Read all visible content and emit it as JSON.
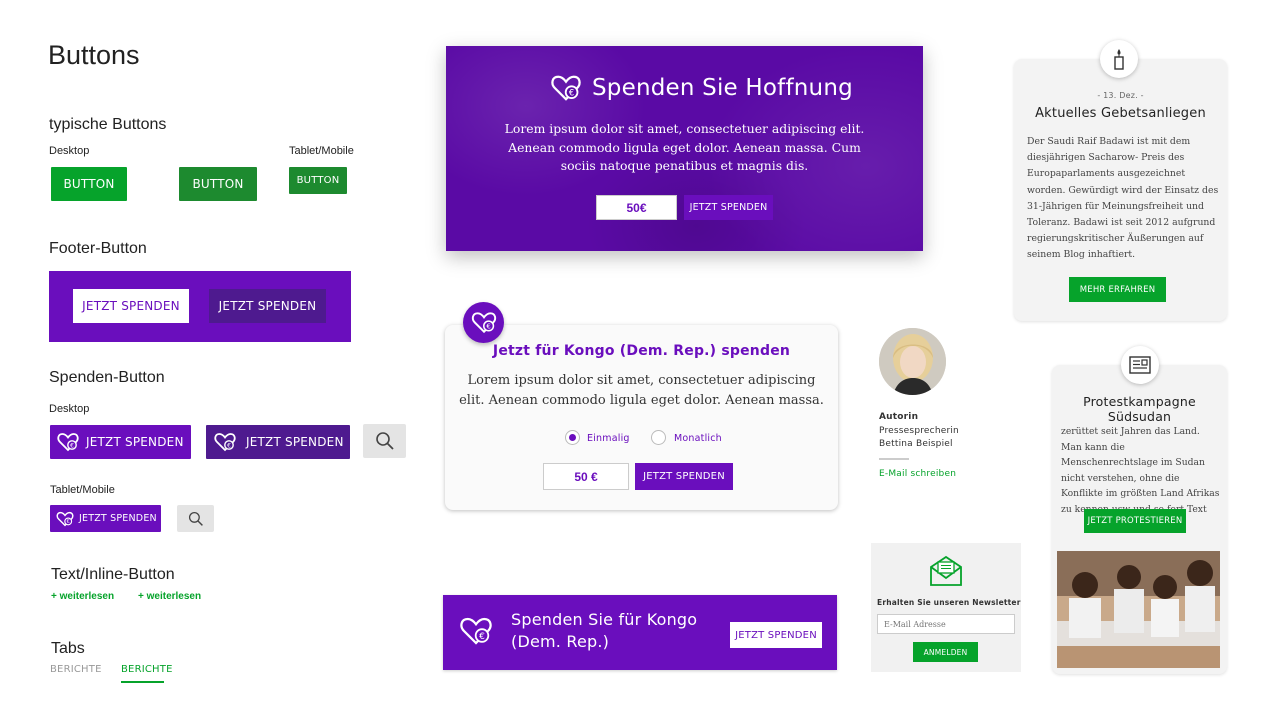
{
  "page": {
    "title": "Buttons"
  },
  "typical": {
    "heading": "typische Buttons",
    "desktop_label": "Desktop",
    "tablet_label": "Tablet/Mobile",
    "button_label": "BUTTON"
  },
  "footer_section": {
    "heading": "Footer-Button",
    "btn_primary": "JETZT SPENDEN",
    "btn_secondary": "JETZT SPENDEN"
  },
  "spenden_section": {
    "heading": "Spenden-Button",
    "desktop_label": "Desktop",
    "tablet_label": "Tablet/Mobile",
    "btn_label": "JETZT SPENDEN"
  },
  "inline_section": {
    "heading": "Text/Inline-Button",
    "link1": "+ weiterlesen",
    "link2": "+ weiterlesen"
  },
  "tabs_section": {
    "heading": "Tabs",
    "tab_inactive": "BERICHTE",
    "tab_active": "BERICHTE"
  },
  "hero": {
    "title": "Spenden Sie Hoffnung",
    "body": "Lorem ipsum dolor sit amet, consectetuer adipiscing elit. Aenean commodo ligula eget dolor. Aenean massa. Cum sociis natoque penatibus et magnis dis.",
    "amount": "50€",
    "button": "JETZT SPENDEN"
  },
  "donation_card": {
    "title": "Jetzt für Kongo (Dem. Rep.) spenden",
    "body": "Lorem ipsum dolor sit amet, consectetuer adipiscing elit. Aenean commodo ligula eget dolor. Aenean massa.",
    "option_once": "Einmalig",
    "option_monthly": "Monatlich",
    "amount": "50 €",
    "button": "JETZT SPENDEN"
  },
  "bottom_banner": {
    "title_line1": "Spenden Sie für Kongo",
    "title_line2": "(Dem. Rep.)",
    "button": "JETZT SPENDEN"
  },
  "author": {
    "label": "Autorin",
    "role": "Pressesprecherin",
    "name": "Bettina Beispiel",
    "email_link": "E-Mail schreiben"
  },
  "newsletter": {
    "label": "Erhalten Sie unseren Newsletter",
    "placeholder": "E-Mail Adresse",
    "button": "ANMELDEN"
  },
  "prayer_card": {
    "date": "- 13. Dez. -",
    "title": "Aktuelles Gebetsanliegen",
    "body": "Der Saudi Raif Badawi ist mit dem diesjährigen Sacharow- Preis des Europaparlaments ausgezeichnet worden. Gewürdigt wird der Einsatz des 31-Jährigen für Meinungsfreiheit und Toleranz. Badawi ist seit 2012 aufgrund regierungskritischer Äußerungen auf seinem Blog inhaftiert.",
    "button": "MEHR ERFAHREN"
  },
  "protest_card": {
    "title": "Protestkampagne Südsudan",
    "body": "zerüttet seit Jahren das Land. Man kann die Menschenrechtslage im Sudan nicht verstehen, ohne die Konflikte im größten Land Afrikas zu kennen usw und so fort Text",
    "button": "JETZT PROTESTIEREN"
  },
  "colors": {
    "purple": "#6a0ebd",
    "purple_dark": "#4e1a8f",
    "green": "#06a32b",
    "green_dark": "#1d8a2f"
  },
  "icons": [
    "heart-euro-icon",
    "search-icon",
    "candle-icon",
    "newspaper-icon",
    "envelope-icon"
  ]
}
